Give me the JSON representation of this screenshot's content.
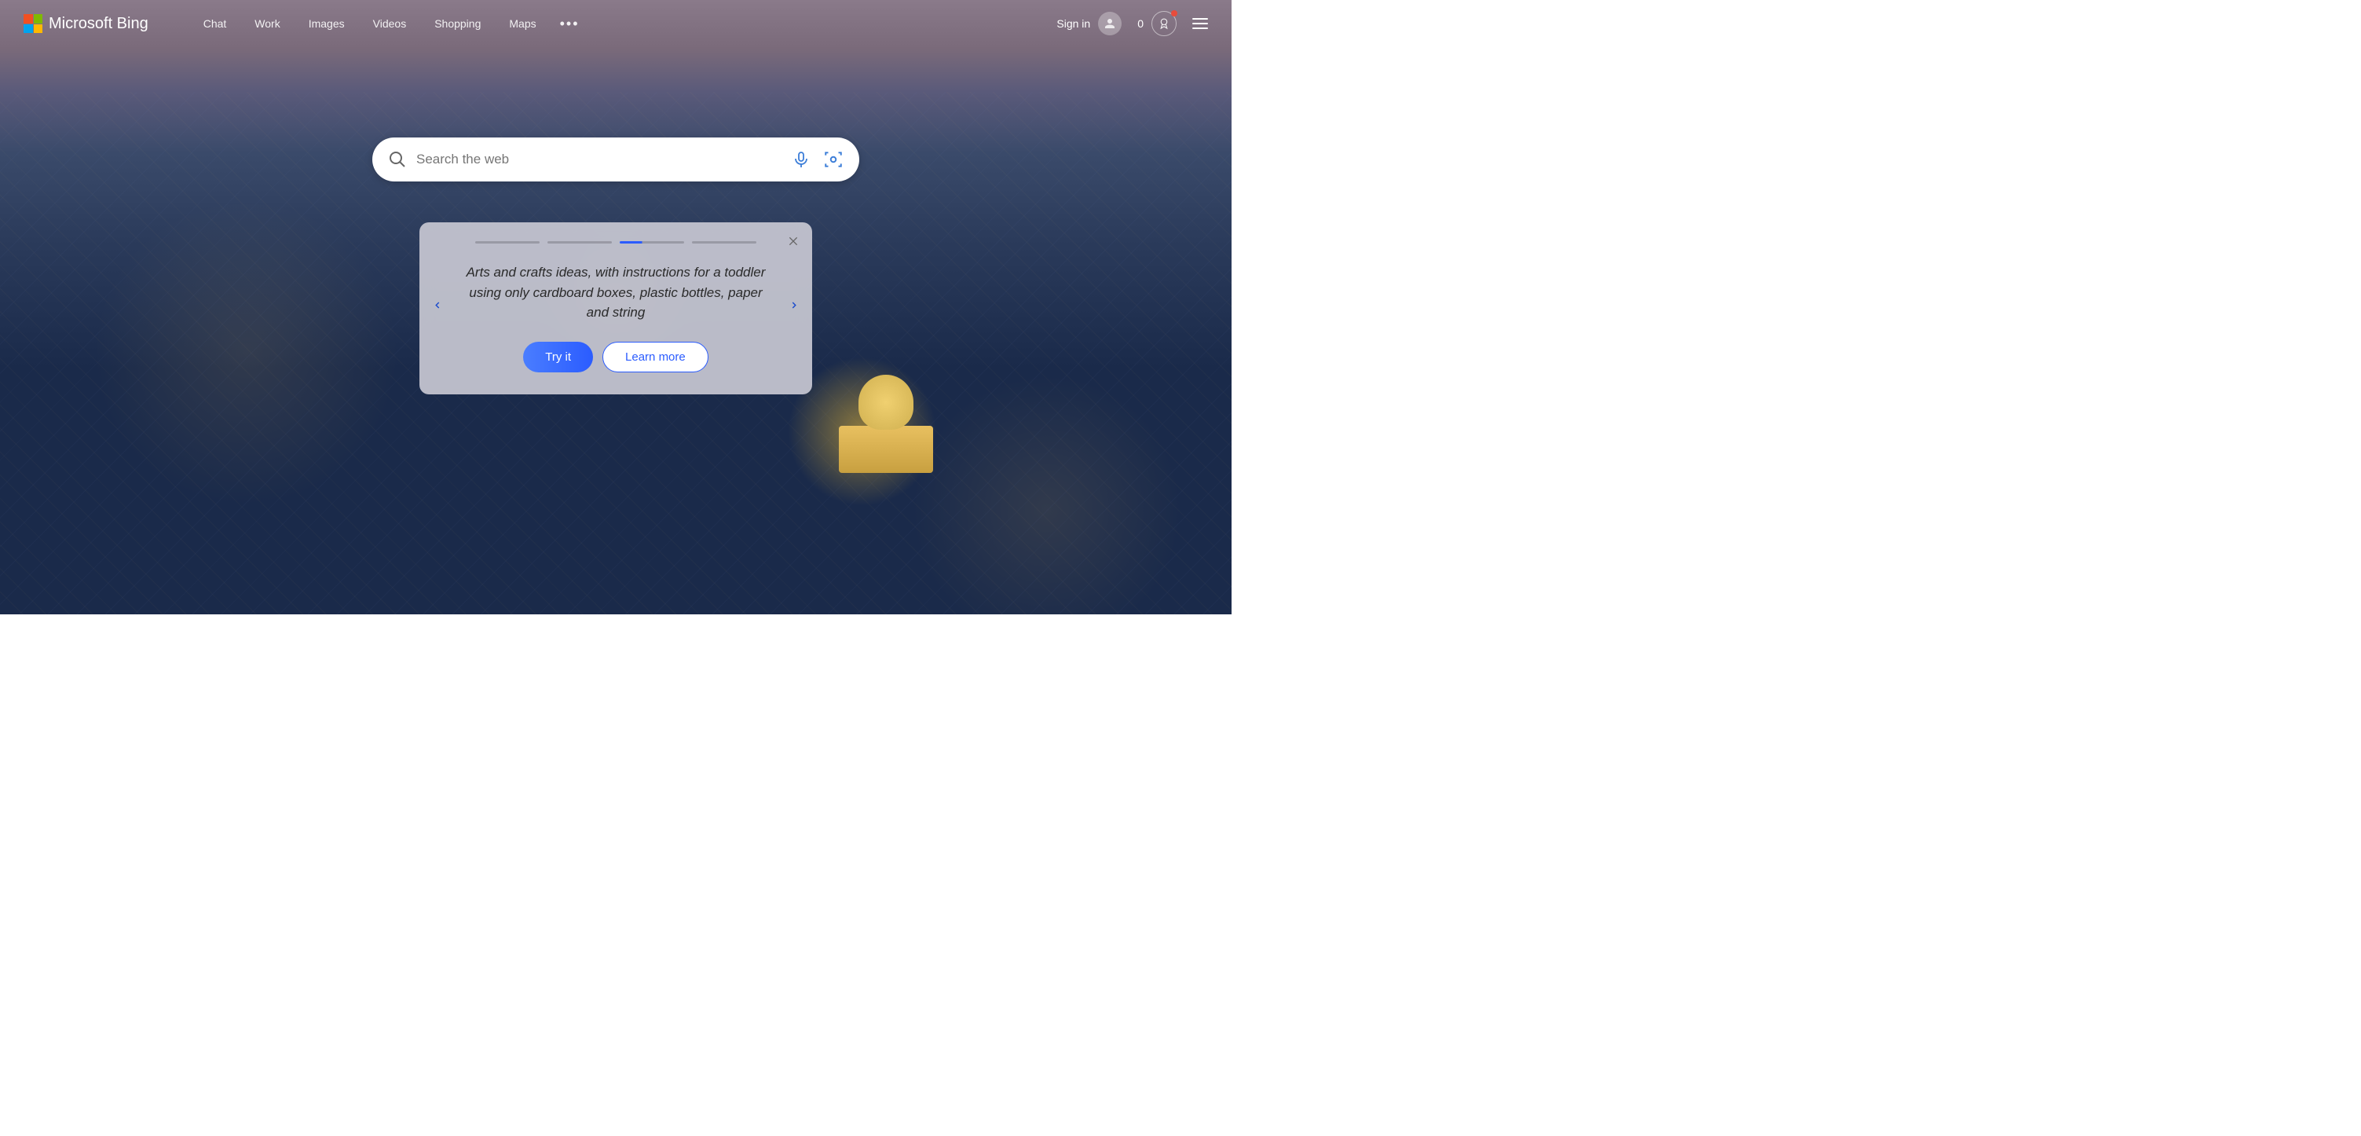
{
  "logo": {
    "text": "Microsoft Bing"
  },
  "nav": {
    "items": [
      "Chat",
      "Work",
      "Images",
      "Videos",
      "Shopping",
      "Maps"
    ],
    "more": "•••"
  },
  "header_right": {
    "signin": "Sign in",
    "rewards_count": "0"
  },
  "search": {
    "placeholder": "Search the web"
  },
  "promo": {
    "active_index": 2,
    "total_slides": 4,
    "text": "Arts and crafts ideas, with instructions for a toddler using only cardboard boxes, plastic bottles, paper and string",
    "try_button": "Try it",
    "learn_button": "Learn more"
  }
}
